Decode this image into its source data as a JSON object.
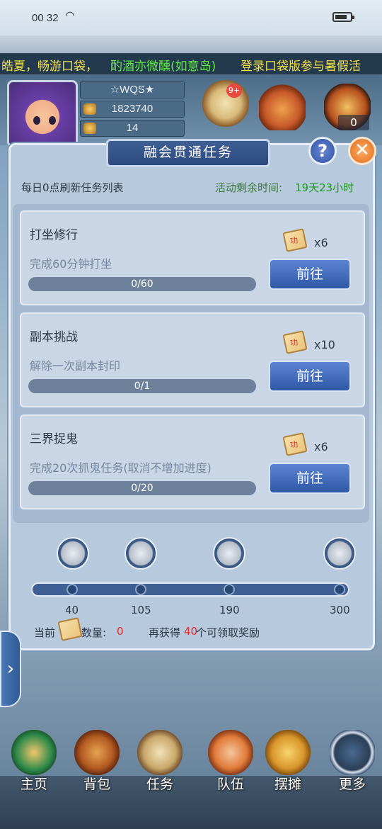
{
  "status": {
    "time": "00 32"
  },
  "marquee": {
    "part1": "皓夏，畅游口袋，",
    "part2": "酌酒亦微醺(如意岛)",
    "part3": "登录口袋版参与暑假活"
  },
  "player": {
    "name": "☆WQS★",
    "gold": "1823740",
    "bag": "14",
    "badge": "9+",
    "item_count": "0"
  },
  "panel": {
    "title": "融会贯通任务",
    "help": "?",
    "close": "✕",
    "refresh_text": "每日0点刷新任务列表",
    "remain_label": "活动剩余时间:",
    "remain_value": "19天23小时"
  },
  "tasks": [
    {
      "title": "打坐修行",
      "desc": "完成60分钟打坐",
      "progress": "0/60",
      "reward": "x6",
      "button": "前往"
    },
    {
      "title": "副本挑战",
      "desc": "解除一次副本封印",
      "progress": "0/1",
      "reward": "x10",
      "button": "前往"
    },
    {
      "title": "三界捉鬼",
      "desc": "完成20次抓鬼任务(取消不增加进度)",
      "progress": "0/20",
      "reward": "x6",
      "button": "前往"
    }
  ],
  "milestones": [
    "40",
    "105",
    "190",
    "300"
  ],
  "footer": {
    "current": "当前",
    "count_label": "数量:",
    "count": "0",
    "more_a": "再获得",
    "more_n": "40",
    "more_b": "个可领取奖励"
  },
  "side_tab": "›",
  "nav": [
    {
      "label": "主页",
      "icon": "home-icon"
    },
    {
      "label": "背包",
      "icon": "chest-icon"
    },
    {
      "label": "任务",
      "icon": "scroll-icon"
    },
    {
      "label": "队伍",
      "icon": "team-icon"
    },
    {
      "label": "摆摊",
      "icon": "coin-icon"
    },
    {
      "label": "更多",
      "icon": "more-icon"
    }
  ],
  "colors": {
    "accent_blue": "#2f58a8",
    "remaining_green": "#1a9b1a",
    "highlight_red": "#e02b2b",
    "marquee_yellow": "#f5e04a",
    "marquee_green": "#66e84a"
  }
}
